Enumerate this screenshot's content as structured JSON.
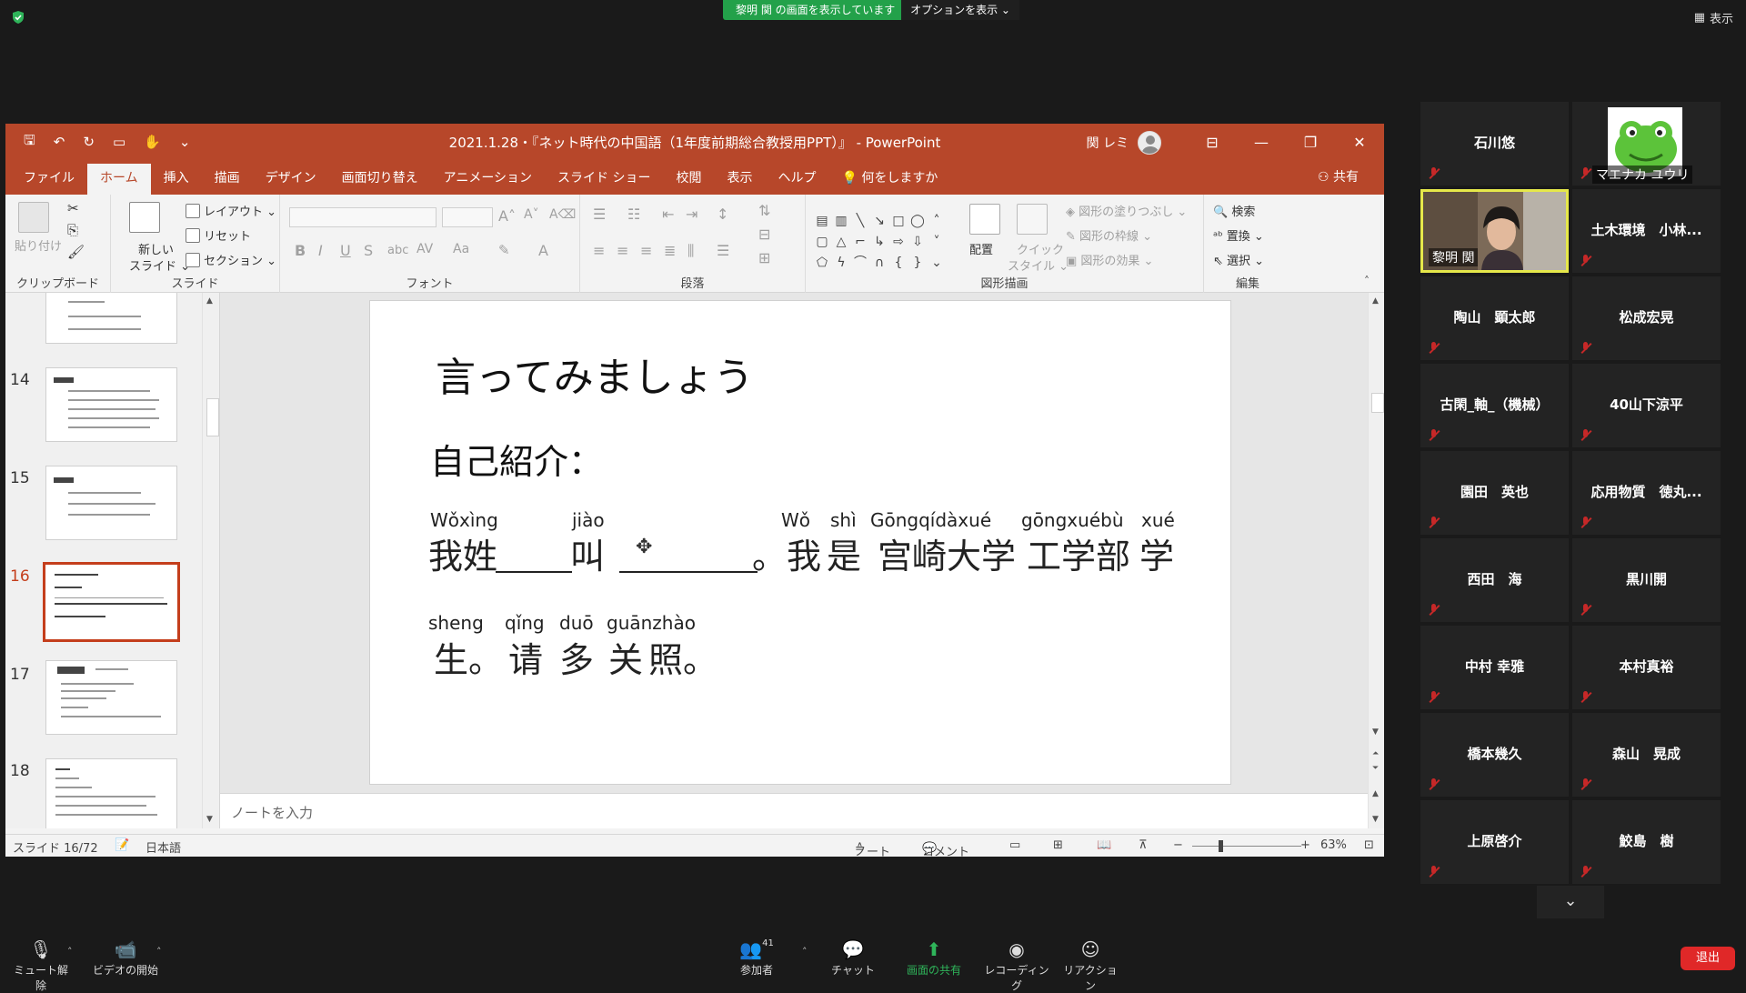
{
  "zoom": {
    "share_banner": "黎明 関 の画面を表示しています",
    "view_options": "オプションを表示 ⌄",
    "view_mode": "表示",
    "toolbar": {
      "mute": "ミュート解除",
      "video": "ビデオの開始",
      "participants": "参加者",
      "participants_count": "41",
      "chat": "チャット",
      "share": "画面の共有",
      "record": "レコーディング",
      "reactions": "リアクション",
      "leave": "退出"
    }
  },
  "ppt": {
    "title": "2021.1.28・『ネット時代の中国語（1年度前期総合教授用PPT）』 - PowerPoint",
    "user": "関 レミ",
    "tabs": [
      "ファイル",
      "ホーム",
      "挿入",
      "描画",
      "デザイン",
      "画面切り替え",
      "アニメーション",
      "スライド ショー",
      "校閲",
      "表示",
      "ヘルプ",
      "何をしますか"
    ],
    "active_tab": "ホーム",
    "share": "共有",
    "ribbon": {
      "clipboard_label": "クリップボード",
      "paste": "貼り付け",
      "slides_label": "スライド",
      "new_slide_1": "新しい",
      "new_slide_2": "スライド ⌄",
      "layout": "レイアウト ⌄",
      "reset": "リセット",
      "section": "セクション ⌄",
      "font_label": "フォント",
      "paragraph_label": "段落",
      "drawing_label": "図形描画",
      "arrange": "配置",
      "quick_style_1": "クイック",
      "quick_style_2": "スタイル ⌄",
      "shape_fill": "図形の塗りつぶし ⌄",
      "shape_outline": "図形の枠線 ⌄",
      "shape_effect": "図形の効果 ⌄",
      "editing_label": "編集",
      "find": "検索",
      "replace": "置換 ⌄",
      "select": "選択 ⌄"
    },
    "thumbnails": [
      "14",
      "15",
      "16",
      "17",
      "18"
    ],
    "selected_thumb": "16",
    "slide": {
      "title": "言ってみましょう",
      "subtitle": "自己紹介：",
      "pinyin_line1": [
        "Wǒxìng",
        "jiào",
        "Wǒ",
        "shì",
        "Gōngqídàxué",
        "gōngxuébù",
        "xué"
      ],
      "hanzi_line1": [
        "我姓",
        "叫",
        "。我",
        "是",
        "宫崎大学",
        "工学部",
        "学"
      ],
      "pinyin_line2": [
        "sheng",
        "qǐng",
        "duō",
        "guānzhào"
      ],
      "hanzi_line2": [
        "生。",
        "请",
        "多",
        "关",
        "照。"
      ]
    },
    "notes_placeholder": "ノートを入力",
    "status": {
      "slide_count": "スライド 16/72",
      "language": "日本語",
      "notes": "ノート",
      "comments": "コメント",
      "zoom": "63%"
    }
  },
  "participants": [
    {
      "name": "石川悠",
      "muted": true
    },
    {
      "name": "マエナカ ユウリ",
      "muted": true,
      "avatar": true
    },
    {
      "name": "黎明 関",
      "muted": false,
      "video": true
    },
    {
      "name": "土木環境　小林...",
      "muted": true
    },
    {
      "name": "陶山　顕太郎",
      "muted": true
    },
    {
      "name": "松成宏晃",
      "muted": true
    },
    {
      "name": "古閑_軸_（機械）",
      "muted": true
    },
    {
      "name": "40山下涼平",
      "muted": true
    },
    {
      "name": "園田　英也",
      "muted": true
    },
    {
      "name": "応用物質　徳丸...",
      "muted": true
    },
    {
      "name": "西田　海",
      "muted": true
    },
    {
      "name": "黒川開",
      "muted": true
    },
    {
      "name": "中村 幸雅",
      "muted": true
    },
    {
      "name": "本村真裕",
      "muted": true
    },
    {
      "name": "橋本幾久",
      "muted": true
    },
    {
      "name": "森山　晃成",
      "muted": true
    },
    {
      "name": "上原啓介",
      "muted": true
    },
    {
      "name": "鮫島　樹",
      "muted": true
    }
  ],
  "colors": {
    "ppt_accent": "#b7472a",
    "zoom_green": "#23a14a",
    "leave_red": "#e02828",
    "active_speaker": "#e6e84a"
  }
}
